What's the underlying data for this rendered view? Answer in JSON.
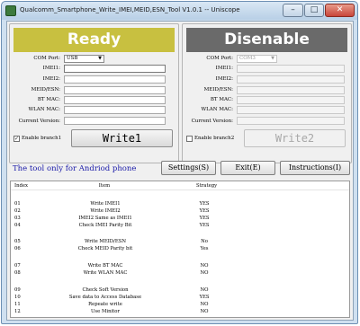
{
  "window": {
    "title": "Qualcomm_Smartphone_Write_IMEI,MEID,ESN_Tool V1.0.1 -- Uniscope"
  },
  "window_buttons": {
    "minimize": "–",
    "maximize": "□",
    "close": "✕"
  },
  "left_panel": {
    "banner": "Ready",
    "com_port_label": "COM Port:",
    "com_port_value": "USB",
    "fields": [
      {
        "label": "IMEI1:",
        "value": ""
      },
      {
        "label": "IMEI2:",
        "value": ""
      },
      {
        "label": "MEID/ESN:",
        "value": ""
      },
      {
        "label": "BT MAC:",
        "value": ""
      },
      {
        "label": "WLAN MAC:",
        "value": ""
      },
      {
        "label": "Current Version:",
        "value": ""
      }
    ],
    "enable_label": "Enable branch1",
    "enable_checked": true,
    "write_button": "Write1"
  },
  "right_panel": {
    "banner": "Disenable",
    "com_port_label": "COM Port:",
    "com_port_value": "COM3",
    "fields": [
      {
        "label": "IMEI1:",
        "value": ""
      },
      {
        "label": "IMEI2:",
        "value": ""
      },
      {
        "label": "MEID/ESN:",
        "value": ""
      },
      {
        "label": "BT MAC:",
        "value": ""
      },
      {
        "label": "WLAN MAC:",
        "value": ""
      },
      {
        "label": "Current Version:",
        "value": ""
      }
    ],
    "enable_label": "Enable branch2",
    "enable_checked": false,
    "write_button": "Write2"
  },
  "tool_note": "The tool only for Andriod phone",
  "actions": {
    "settings": "Settings(S)",
    "exit": "Exit(E)",
    "instructions": "Instructions(I)"
  },
  "table": {
    "headers": [
      "Index",
      "Item",
      "Strategy"
    ],
    "rows": [
      {
        "index": "01",
        "item": "Write IMEI1",
        "strategy": "YES"
      },
      {
        "index": "02",
        "item": "Write IMEI2",
        "strategy": "YES"
      },
      {
        "index": "03",
        "item": "IMEI2 Same as IMEI1",
        "strategy": "YES"
      },
      {
        "index": "04",
        "item": "Check IMEI Parity Bit",
        "strategy": "YES"
      },
      {
        "index": "05",
        "item": "Write MEID/ESN",
        "strategy": "No"
      },
      {
        "index": "06",
        "item": "Check MEID Parity bit",
        "strategy": "Yes"
      },
      {
        "index": "07",
        "item": "Write BT MAC",
        "strategy": "NO"
      },
      {
        "index": "08",
        "item": "Write WLAN MAC",
        "strategy": "NO"
      },
      {
        "index": "09",
        "item": "Check Soft Version",
        "strategy": "NO"
      },
      {
        "index": "10",
        "item": "Save data to Access Database",
        "strategy": "YES"
      },
      {
        "index": "11",
        "item": "Repeate write",
        "strategy": "NO"
      },
      {
        "index": "12",
        "item": "Use Minitor",
        "strategy": "NO"
      }
    ]
  },
  "colors": {
    "ready_banner": "#c8c040",
    "disable_banner": "#6a6a6a",
    "note_text": "#1a1aa8"
  }
}
